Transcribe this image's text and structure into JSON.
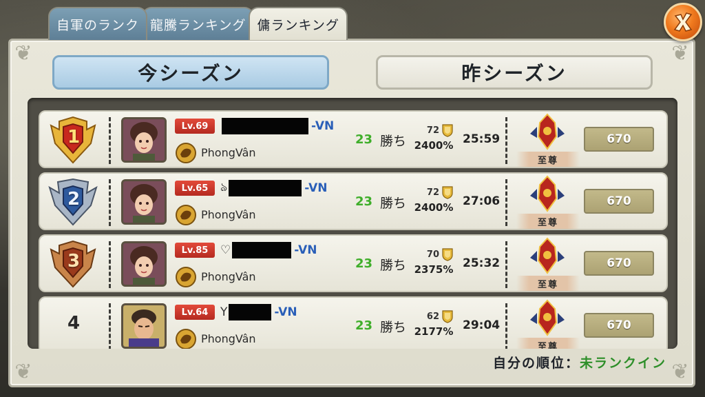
{
  "tabs": [
    {
      "label": "自軍のランク"
    },
    {
      "label": "龍騰ランキング"
    },
    {
      "label": "傭ランキング"
    }
  ],
  "season_buttons": {
    "current": "今シーズン",
    "previous": "昨シーズン"
  },
  "rows": [
    {
      "rank": "1",
      "level": "Lv.69",
      "name_prefix": "",
      "name_suffix": "-VN",
      "guild": "PhongVân",
      "wins": "23",
      "wins_label": "勝ち",
      "count": "72",
      "percent": "2400%",
      "time": "25:59",
      "tier": "至尊",
      "score": "670"
    },
    {
      "rank": "2",
      "level": "Lv.65",
      "name_prefix": "ঌ",
      "name_suffix": "-VN",
      "guild": "PhongVân",
      "wins": "23",
      "wins_label": "勝ち",
      "count": "72",
      "percent": "2400%",
      "time": "27:06",
      "tier": "至尊",
      "score": "670"
    },
    {
      "rank": "3",
      "level": "Lv.85",
      "name_prefix": "♡",
      "name_suffix": "-VN",
      "guild": "PhongVân",
      "wins": "23",
      "wins_label": "勝ち",
      "count": "70",
      "percent": "2375%",
      "time": "25:32",
      "tier": "至尊",
      "score": "670"
    },
    {
      "rank": "4",
      "level": "Lv.64",
      "name_prefix": "Y",
      "name_suffix": "-VN",
      "guild": "PhongVân",
      "wins": "23",
      "wins_label": "勝ち",
      "count": "62",
      "percent": "2177%",
      "time": "29:04",
      "tier": "至尊",
      "score": "670"
    }
  ],
  "my_rank": {
    "label": "自分の順位：",
    "value": "未ランクイン"
  },
  "colors": {
    "gold_medal": "#d9a32a",
    "silver_medal": "#7d8fa6",
    "bronze_medal": "#b86a3a",
    "wins_green": "#3fae2a",
    "name_blue": "#2a5fb8",
    "level_red": "#c9352a"
  },
  "icons": {
    "close": "close-icon",
    "medal": "rank-medal-icon",
    "guild": "guild-dragon-icon",
    "shield": "shield-icon",
    "tier": "tier-emblem-icon"
  }
}
